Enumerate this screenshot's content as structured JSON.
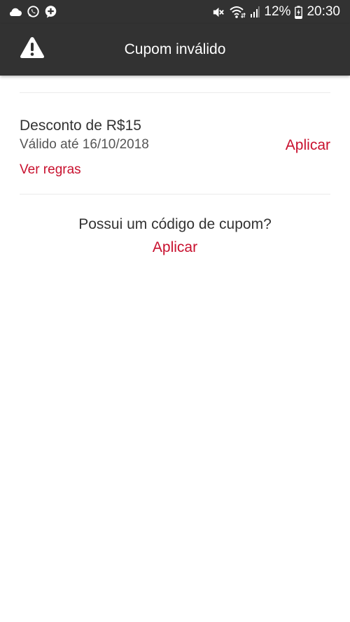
{
  "status_bar": {
    "battery_percent": "12%",
    "time": "20:30",
    "left_icons": [
      "cloud-icon",
      "whatsapp-icon",
      "plus-chat-icon"
    ],
    "right_icons": [
      "mute-icon",
      "wifi-icon",
      "signal-icon",
      "battery-charging-icon"
    ]
  },
  "app_bar": {
    "icon": "warning-icon",
    "title": "Cupom inválido"
  },
  "coupon": {
    "title": "Desconto de R$15",
    "validity": "Válido até 16/10/2018",
    "apply_label": "Aplicar",
    "rules_label": "Ver regras"
  },
  "promo_code": {
    "question": "Possui um código de cupom?",
    "apply_label": "Aplicar"
  },
  "colors": {
    "app_bar": "#323232",
    "accent": "#c8102e",
    "text_primary": "#333333",
    "text_secondary": "#555555",
    "divider": "#ebebeb"
  }
}
